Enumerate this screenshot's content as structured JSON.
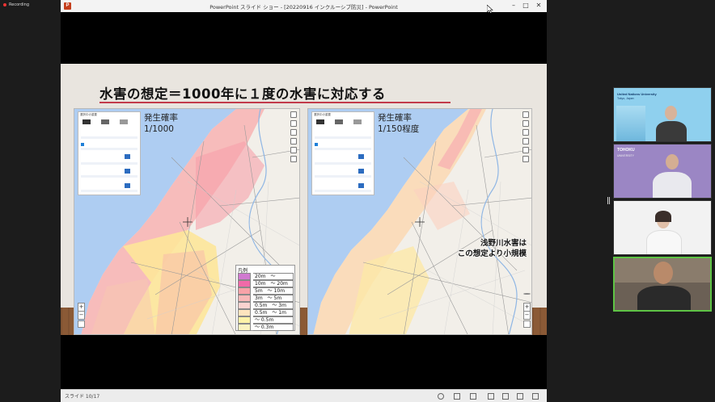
{
  "recording": {
    "label": "Recording",
    "color": "#e33333"
  },
  "window": {
    "title": "PowerPoint スライド ショー - [20220916 インクルーシブ防災] - PowerPoint",
    "controls": {
      "minimize": "–",
      "maximize": "□",
      "close": "✕"
    }
  },
  "slide": {
    "title": "水害の想定＝1000年に１度の水害に対応する",
    "accent_color": "#c23b4b",
    "left_map": {
      "probability_label": "発生確率",
      "probability_value": "1/1000",
      "legend": {
        "title": "凡例",
        "items": [
          {
            "label": "20m　～",
            "color": "#d07ad0"
          },
          {
            "label": "10m　～ 20m",
            "color": "#f06aa8"
          },
          {
            "label": "5m　～ 10m",
            "color": "#f8a2a8"
          },
          {
            "label": "3m　～ 5m",
            "color": "#f8b8b8"
          },
          {
            "label": "0.5m　～ 3m",
            "color": "#fbd3d0"
          },
          {
            "label": "0.5m　～ 1m",
            "color": "#fde4be"
          },
          {
            "label": "～ 0.5m",
            "color": "#fdf2a8"
          },
          {
            "label": "～ 0.3m",
            "color": "#fbf3c0"
          }
        ]
      }
    },
    "right_map": {
      "probability_label": "発生確率",
      "probability_value": "1/150程度",
      "note_line1": "浅野川水害は",
      "note_line2": "この想定より小規模"
    },
    "zoom_in": "+",
    "zoom_out": "−"
  },
  "statusbar": {
    "slide_indicator": "スライド 10/17"
  },
  "participants": [
    {
      "caption": "United Nations University",
      "sub": "Tokyo, Japan",
      "bg": "#8fd0ee"
    },
    {
      "caption": "TOHOKU",
      "sub": "UNIVERSITY",
      "bg": "#9b86c4"
    },
    {
      "caption": "",
      "sub": "",
      "bg": "#f2f2f2"
    },
    {
      "caption": "",
      "sub": "",
      "bg": "#6b6055",
      "active_color": "#5ec445"
    }
  ]
}
